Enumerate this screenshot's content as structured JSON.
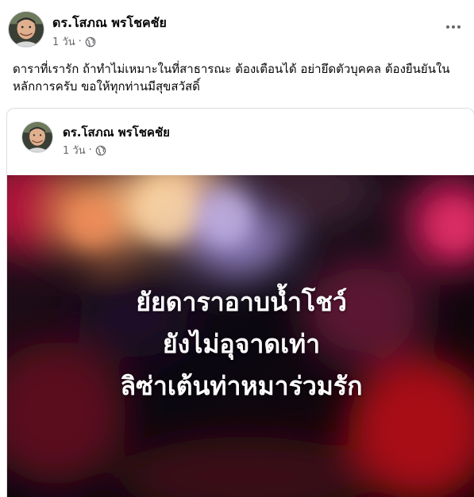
{
  "post": {
    "author": "ดร.โสภณ พรโชคชัย",
    "time": "1 วัน",
    "separator": "·",
    "text": "ดาราที่เรารัก ถ้าทำไม่เหมาะในที่สาธารณะ ต้องเตือนได้ อย่ายึดตัวบุคคล ต้องยืนยันในหลักการครับ ขอให้ทุกท่านมีสุขสวัสดิ์"
  },
  "shared_post": {
    "author": "ดร.โสภณ พรโชคชัย",
    "time": "1 วัน",
    "separator": "·",
    "headline_lines": [
      "ยัยดาราอาบน้ำโชว์",
      "ยังไม่อุจาดเท่า",
      "ลิซ่าเต้นท่าหมาร่วมรัก"
    ]
  },
  "icons": {
    "more": "more-horizontal-icon",
    "privacy": "globe-icon"
  },
  "colors": {
    "text_primary": "#050505",
    "text_secondary": "#65676b",
    "card_border": "#dadde1"
  }
}
